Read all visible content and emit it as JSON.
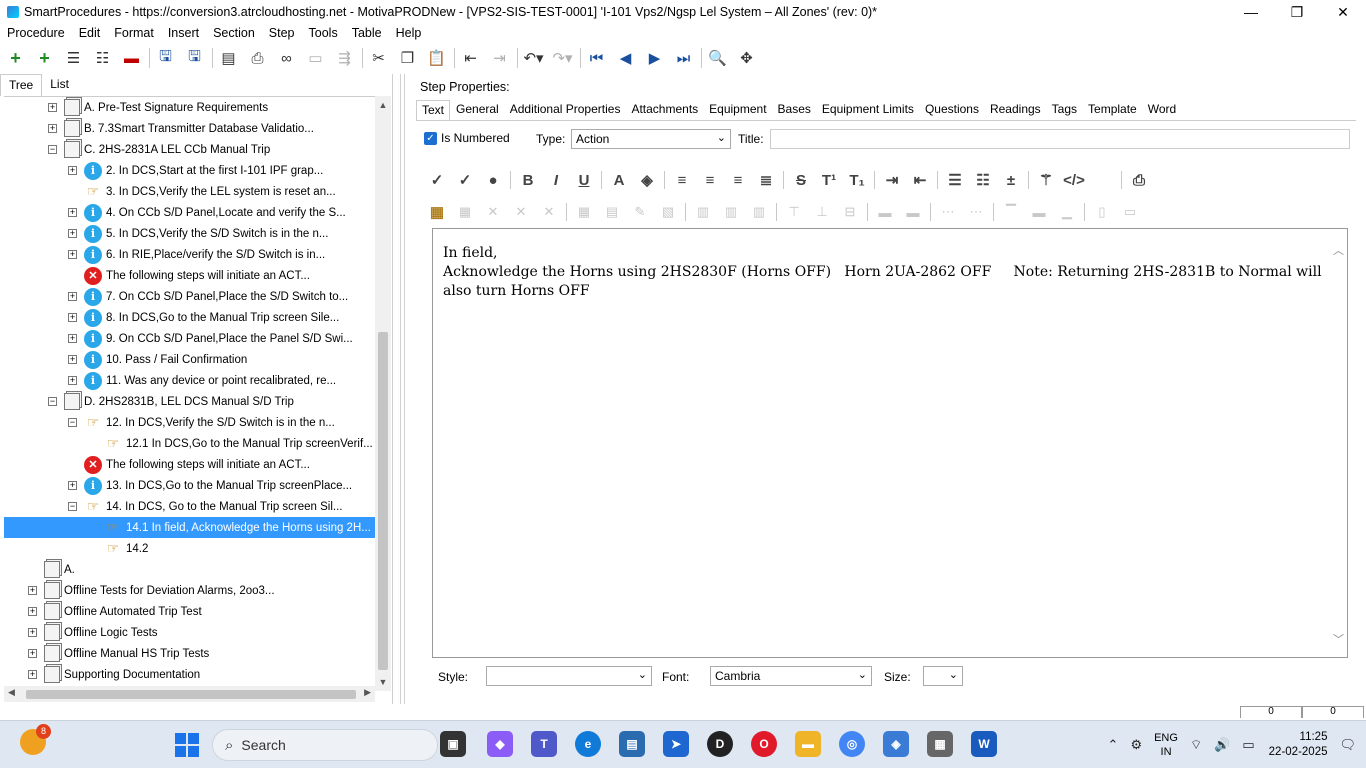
{
  "window": {
    "title": "SmartProcedures - https://conversion3.atrcloudhosting.net - MotivaPRODNew - [VPS2-SIS-TEST-0001] 'I-101 Vps2/Ngsp Lel System – All Zones' (rev: 0)*",
    "minimize": "—",
    "maximize": "❐",
    "close": "✕"
  },
  "menu": [
    "Procedure",
    "Edit",
    "Format",
    "Insert",
    "Section",
    "Step",
    "Tools",
    "Table",
    "Help"
  ],
  "left_tabs": [
    "Tree",
    "List"
  ],
  "tree": [
    {
      "level": 1,
      "icon": "doc",
      "exp": "+",
      "label": "A. Pre-Test Signature Requirements"
    },
    {
      "level": 1,
      "icon": "doc",
      "exp": "+",
      "label": "B. 7.3Smart Transmitter Database Validatio..."
    },
    {
      "level": 1,
      "icon": "doc",
      "exp": "−",
      "label": "C. 2HS-2831A LEL CCb Manual Trip"
    },
    {
      "level": 2,
      "icon": "info",
      "exp": "+",
      "label": "2. In DCS,Start at the first I-101 IPF grap..."
    },
    {
      "level": 2,
      "icon": "hand",
      "exp": "",
      "label": "3. In DCS,Verify the LEL system is reset an..."
    },
    {
      "level": 2,
      "icon": "info",
      "exp": "+",
      "label": "4. On CCb S/D Panel,Locate and verify the S..."
    },
    {
      "level": 2,
      "icon": "info",
      "exp": "+",
      "label": "5. In DCS,Verify the S/D Switch is in the n..."
    },
    {
      "level": 2,
      "icon": "info",
      "exp": "+",
      "label": "6. In RIE,Place/verify the S/D Switch is in..."
    },
    {
      "level": 2,
      "icon": "err",
      "exp": "",
      "label": "The following steps will initiate an ACT..."
    },
    {
      "level": 2,
      "icon": "info",
      "exp": "+",
      "label": "7. On CCb S/D Panel,Place the S/D Switch to..."
    },
    {
      "level": 2,
      "icon": "info",
      "exp": "+",
      "label": "8. In DCS,Go to the Manual Trip screen Sile..."
    },
    {
      "level": 2,
      "icon": "info",
      "exp": "+",
      "label": "9. On CCb S/D Panel,Place the Panel S/D Swi..."
    },
    {
      "level": 2,
      "icon": "info",
      "exp": "+",
      "label": "10. Pass / Fail Confirmation"
    },
    {
      "level": 2,
      "icon": "info",
      "exp": "+",
      "label": "11. Was any device or point recalibrated, re..."
    },
    {
      "level": 1,
      "icon": "doc",
      "exp": "−",
      "label": "D. 2HS2831B, LEL DCS Manual S/D Trip"
    },
    {
      "level": 2,
      "icon": "hand",
      "exp": "−",
      "label": "12. In DCS,Verify the S/D Switch is in the n..."
    },
    {
      "level": 3,
      "icon": "hand",
      "exp": "",
      "label": "12.1 In DCS,Go to the Manual Trip screenVerif..."
    },
    {
      "level": 2,
      "icon": "err",
      "exp": "",
      "label": "The following steps will initiate an ACT..."
    },
    {
      "level": 2,
      "icon": "info",
      "exp": "+",
      "label": "13. In DCS,Go to the Manual Trip screenPlace..."
    },
    {
      "level": 2,
      "icon": "hand",
      "exp": "−",
      "label": "14. In DCS, Go to the Manual Trip screen Sil..."
    },
    {
      "level": 3,
      "icon": "hand",
      "exp": "",
      "label": "14.1 In field, Acknowledge the Horns using 2H...",
      "selected": true
    },
    {
      "level": 3,
      "icon": "hand",
      "exp": "",
      "label": "14.2"
    },
    {
      "level": 0,
      "icon": "doc",
      "exp": "",
      "label": "A."
    },
    {
      "level": 0,
      "icon": "doc",
      "exp": "+",
      "label": "Offline Tests for Deviation Alarms, 2oo3..."
    },
    {
      "level": 0,
      "icon": "doc",
      "exp": "+",
      "label": "Offline Automated Trip Test"
    },
    {
      "level": 0,
      "icon": "doc",
      "exp": "+",
      "label": "Offline Logic Tests"
    },
    {
      "level": 0,
      "icon": "doc",
      "exp": "+",
      "label": "Offline Manual HS Trip Tests"
    },
    {
      "level": 0,
      "icon": "doc",
      "exp": "+",
      "label": "Supporting Documentation"
    }
  ],
  "step_properties": {
    "label": "Step Properties:",
    "tabs": [
      "Text",
      "General",
      "Additional Properties",
      "Attachments",
      "Equipment",
      "Bases",
      "Equipment Limits",
      "Questions",
      "Readings",
      "Tags",
      "Template",
      "Word"
    ],
    "is_numbered_label": "Is Numbered",
    "is_numbered_check": "✓",
    "type_label": "Type:",
    "type_value": "Action",
    "title_label": "Title:",
    "title_value": ""
  },
  "editor": {
    "line1": "In field,",
    "line2": "Acknowledge the Horns using 2HS2830F (Horns OFF)   Horn 2UA-2862 OFF     Note: Returning 2HS-2831B to Normal will also turn Horns OFF"
  },
  "bottom": {
    "style_label": "Style:",
    "style_value": "",
    "font_label": "Font:",
    "font_value": "Cambria",
    "size_label": "Size:",
    "size_value": ""
  },
  "status_mini": [
    "0",
    "0"
  ],
  "taskbar": {
    "weather_badge": "8",
    "search_placeholder": "Search",
    "lang_top": "ENG",
    "lang_bottom": "IN",
    "time": "11:25",
    "date": "22-02-2025"
  },
  "colors": {
    "selection": "#3399ff",
    "info_icon": "#2aa7e8",
    "error_icon": "#e02020",
    "taskbar": "#dfe8f2"
  }
}
